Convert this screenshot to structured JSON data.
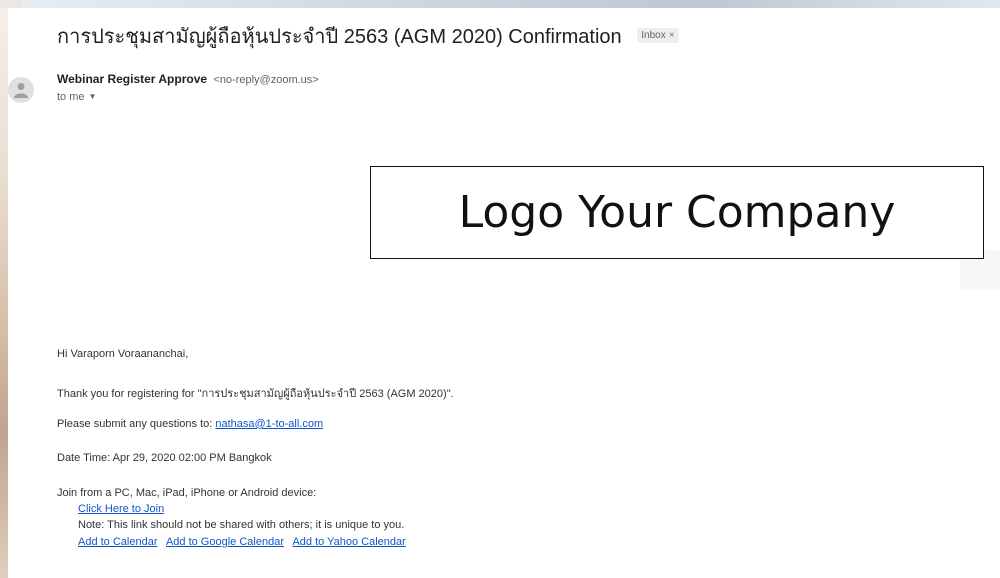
{
  "email": {
    "subject": "การประชุมสามัญผู้ถือหุ้นประจำปี 2563 (AGM 2020) Confirmation",
    "label_badge": "Inbox",
    "label_close": "×",
    "sender_name": "Webinar Register Approve",
    "sender_email": "<no-reply@zoom.us>",
    "recipient": "to me",
    "logo_text": "Logo Your Company",
    "greeting": "Hi Varaporn Voraananchai,",
    "thanks_prefix": "Thank you for registering for \"",
    "thanks_event": "การประชุมสามัญผู้ถือหุ้นประจำปี 2563 (AGM 2020)",
    "thanks_suffix": "\".",
    "questions_prefix": "Please submit any questions to: ",
    "questions_email": "nathasa@1-to-all.com",
    "datetime": "Date Time: Apr 29, 2020 02:00 PM Bangkok",
    "join_from": "Join from a PC, Mac, iPad, iPhone or Android device:",
    "join_link": "Click Here to Join",
    "note": "Note: This link should not be shared with others; it is unique to you.",
    "calendar_links": [
      "Add to Calendar",
      "Add to Google Calendar",
      "Add to Yahoo Calendar"
    ]
  },
  "icons": {
    "avatar": "person-icon",
    "recipient_menu": "caret-down-icon"
  },
  "colors": {
    "link": "#1155cc",
    "badge_bg": "#eeeeee",
    "avatar_bg": "#e0e0e0"
  }
}
